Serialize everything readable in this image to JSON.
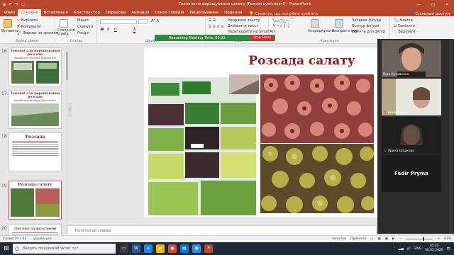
{
  "window": {
    "title": "Технологія вирощування салату [Режим сумісності] - PowerPoint",
    "qat_icons": [
      "save-icon",
      "undo-icon",
      "redo-icon",
      "slideshow-icon"
    ],
    "controls": [
      "—",
      "▢",
      "✕"
    ]
  },
  "ribbon_tabs": [
    "Файл",
    "Основне",
    "Вставлення",
    "Конструктор",
    "Переходи",
    "Анімація",
    "Показ слайдів",
    "Рецензування",
    "Подання"
  ],
  "active_tab": "Основне",
  "tell_me": "Скажіть, що потрібно зробити",
  "share": "Спільний доступ",
  "ribbon": {
    "clipboard": {
      "paste": "Вставити",
      "cut": "Вирізати",
      "copy": "Копіювати",
      "format": "Формат за зразком",
      "label": "Буфер обміну"
    },
    "slides": {
      "new": "Створити слайд",
      "layout": "Макет",
      "reset": "Скинути",
      "section": "Розділ",
      "label": "Слайди"
    },
    "font": {
      "label": "Шрифт"
    },
    "paragraph": {
      "direction": "Напрямок тексту",
      "align": "Вирівняти текст",
      "smartart": "Перетворити на SmartArt",
      "label": "Абзац"
    },
    "drawing": {
      "arrange": "Упорядкувати",
      "styles": "Експрес-стилі",
      "fill": "Заливка фігури",
      "outline": "Контур фігури",
      "effects": "Ефекти для фігур",
      "label": "Креслення"
    },
    "editing": {
      "find": "Знайти",
      "replace": "Замінити",
      "select": "Виділити",
      "label": "Редагування"
    }
  },
  "meeting": {
    "timer": "Remaining Meeting Time: 02:22",
    "stop": "Stop Share"
  },
  "thumbnails": [
    {
      "num": "16",
      "title": "Теплиці для вирощування розсади",
      "subtitle": "Виробнича теплиця Mitscherlich"
    },
    {
      "num": "17",
      "title": "Теплиці для вирощування розсади",
      "subtitle": "Виробнича теплиця Mitscherlich"
    },
    {
      "num": "18",
      "title": "Розсада",
      "subtitle": ""
    },
    {
      "num": "19",
      "title": "Розсада салату",
      "subtitle": ""
    },
    {
      "num": "20",
      "title": "Догляд за розсадою",
      "subtitle": ""
    }
  ],
  "slide": {
    "title": "Розсада салату"
  },
  "notes_placeholder": "Нотатки до слайда",
  "participants": [
    {
      "name": "Віра Кутовенко"
    },
    {
      "name": "Анна Круча"
    },
    {
      "name": "Ярина Шаркова"
    },
    {
      "name": "Fedir Pryma"
    }
  ],
  "status": {
    "slide_info": "Слайд 19 з 32",
    "language": "українська",
    "notes": "Нотатки",
    "comments": "Примітки",
    "zoom": "83%"
  },
  "taskbar": {
    "search_placeholder": "Введіть пошуковий запит тут",
    "language": "ENG",
    "time": "16:30",
    "date": "30.05.2020"
  },
  "colors": {
    "accent": "#b7472a",
    "slide_title": "#8b1a1a",
    "meeting_bar": "#2d8c3c",
    "stop_button": "#d32f2f"
  }
}
